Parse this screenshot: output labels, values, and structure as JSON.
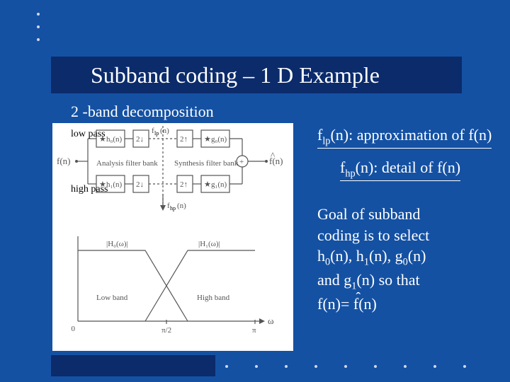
{
  "title": "Subband coding – 1 D Example",
  "subtitle": "2 -band decomposition",
  "labels": {
    "lowpass": "low pass",
    "highpass": "high pass"
  },
  "approx": {
    "fn": "f",
    "sub": "lp",
    "arg": "(n): approximation of f(n)"
  },
  "detail": {
    "fn": "f",
    "sub": "hp",
    "arg": "(n): detail of f(n)"
  },
  "goal": {
    "l1": "Goal of subband",
    "l2": "coding is to select",
    "l3_a": "h",
    "l3_b": "(n), h",
    "l3_c": "(n), g",
    "l3_d": "(n)",
    "l4_a": "and g",
    "l4_b": "(n) so that",
    "l5_a": "f(n)= ",
    "l5_b": "f",
    "l5_c": "(n)"
  },
  "diagram": {
    "fn_in": "f(n)",
    "fn_out": "f(n)",
    "h0": "h₀(n)",
    "h1": "h₁(n)",
    "g0": "g₀(n)",
    "g1": "g₁(n)",
    "down": "2↓",
    "up": "2↑",
    "flp": "f_lp(n)",
    "fhp": "f_hp(n)",
    "analysis": "Analysis filter bank",
    "synthesis": "Synthesis filter bank",
    "H0w": "|H₀(ω)|",
    "H1w": "|H₁(ω)|",
    "lowband": "Low band",
    "highband": "High band",
    "zero": "0",
    "pi2": "π/2",
    "pi": "π",
    "omega": "ω"
  }
}
